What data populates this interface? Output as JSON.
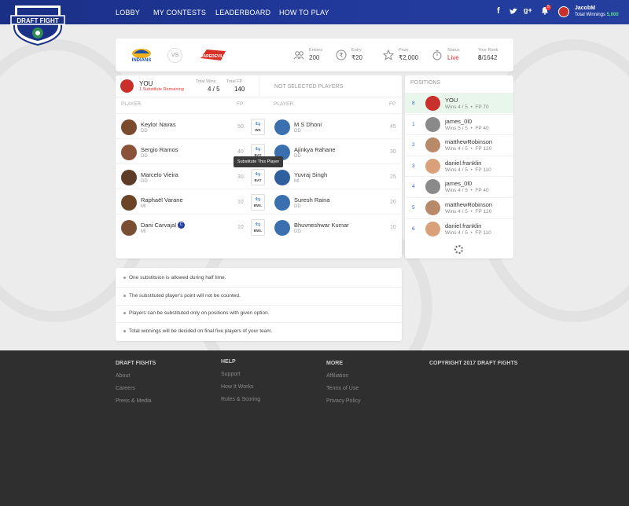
{
  "nav": {
    "links": [
      "LOBBY",
      "MY CONTESTS",
      "LEADERBOARD",
      "HOW TO PLAY"
    ],
    "logo_text": "DRAFT FIGHT",
    "notifications": "5",
    "user": {
      "name": "JacobM",
      "winnings_label": "Total Winnings",
      "winnings_value": "5,000"
    }
  },
  "match": {
    "team1": "INDIANS",
    "vs": "VS",
    "team2": "DAREDEVILS",
    "stats": [
      {
        "icon": "users-icon",
        "label": "Entries",
        "value": "200"
      },
      {
        "icon": "rupee-icon",
        "label": "Entry",
        "value": "₹20"
      },
      {
        "icon": "star-icon",
        "label": "Prize",
        "value": "₹2,000"
      },
      {
        "icon": "timer-icon",
        "label": "Status",
        "value": "Live"
      },
      {
        "icon": "",
        "label": "Your Rank",
        "value_bold": "8",
        "value_rest": "/1642"
      }
    ]
  },
  "you": {
    "name": "YOU",
    "substitute": "1 Substitute Remaining",
    "total_wins_label": "Total Wins",
    "total_wins": "4 / 5",
    "total_fp_label": "Total FP",
    "total_fp": "140"
  },
  "not_selected_title": "NOT SELECTED PLAYERS",
  "col_player": "PLAYER",
  "col_fp": "FP",
  "selected_players": [
    {
      "name": "Keylor Navas",
      "team": "DD",
      "fp": "50",
      "role": "WK",
      "color": "#7a4a2e"
    },
    {
      "name": "Sergio Ramos",
      "team": "DD",
      "fp": "40",
      "role": "BAT",
      "color": "#8a5236"
    },
    {
      "name": "Marcelo Vieira",
      "team": "DD",
      "fp": "30",
      "role": "BAT",
      "color": "#5e3b26"
    },
    {
      "name": "Raphaël Varane",
      "team": "MI",
      "fp": "10",
      "role": "BWL",
      "color": "#6b4428"
    },
    {
      "name": "Dani Carvajal",
      "team": "MI",
      "fp": "10",
      "role": "BWL",
      "color": "#7a4e33",
      "captain": "C"
    }
  ],
  "not_selected_players": [
    {
      "name": "M S Dhoni",
      "team": "DD",
      "fp": "45",
      "color": "#3a6fb0"
    },
    {
      "name": "Ajinkya Rahane",
      "team": "DD",
      "fp": "30",
      "color": "#3a6fb0"
    },
    {
      "name": "Yuvraj Singh",
      "team": "MI",
      "fp": "25",
      "color": "#2f5f9e"
    },
    {
      "name": "Suresh Raina",
      "team": "DD",
      "fp": "20",
      "color": "#3a6fb0"
    },
    {
      "name": "Bhuvneshwar Kumar",
      "team": "DD",
      "fp": "10",
      "color": "#3a6fb0"
    }
  ],
  "tooltip": "Substitute This Player",
  "positions": {
    "title": "POSITIONS",
    "rows": [
      {
        "rank": "8",
        "name": "YOU",
        "wins": "Wins 4 / 5",
        "fp": "FP 70",
        "color": "#c9302c"
      },
      {
        "rank": "1",
        "name": "james_0l0",
        "wins": "Wins 5 / 5",
        "fp": "FP 40",
        "color": "#8a8a8a"
      },
      {
        "rank": "2",
        "name": "matthewRobinson",
        "wins": "Wins 4 / 5",
        "fp": "FP 120",
        "color": "#b98a6a"
      },
      {
        "rank": "3",
        "name": "daniel.franklin",
        "wins": "Wins 4 / 5",
        "fp": "FP 110",
        "color": "#d9a07a"
      },
      {
        "rank": "4",
        "name": "james_0l0",
        "wins": "Wins 4 / 5",
        "fp": "FP 40",
        "color": "#8a8a8a"
      },
      {
        "rank": "5",
        "name": "matthewRobinson",
        "wins": "Wins 4 / 5",
        "fp": "FP 120",
        "color": "#b98a6a"
      },
      {
        "rank": "6",
        "name": "daniel.franklin",
        "wins": "Wins 4 / 5",
        "fp": "FP 110",
        "color": "#d9a07a"
      }
    ]
  },
  "rules": [
    "One substituion is allowed during half time.",
    "The substituted player's point will not be counted.",
    "Players can be substituted only on positions with given option.",
    "Total winnings will be decided on final five players of your team."
  ],
  "footer": {
    "col1": {
      "title": "DRAFT FIGHTS",
      "links": [
        "About",
        "Careers",
        "Press & Media"
      ]
    },
    "col2": {
      "title": "HELP",
      "links": [
        "Support",
        "How It Works",
        "Rules & Scoring"
      ]
    },
    "col3": {
      "title": "MORE",
      "links": [
        "Affiliation",
        "Terms of Use",
        "Privacy Policy"
      ]
    },
    "copyright": "COPYRIGHT 2017 DRAFT FIGHTS"
  },
  "colors": {
    "brand": "#213a9c",
    "live": "#e53935",
    "winnings": "#5fe08a",
    "selected_row": "#e8f6ec"
  }
}
